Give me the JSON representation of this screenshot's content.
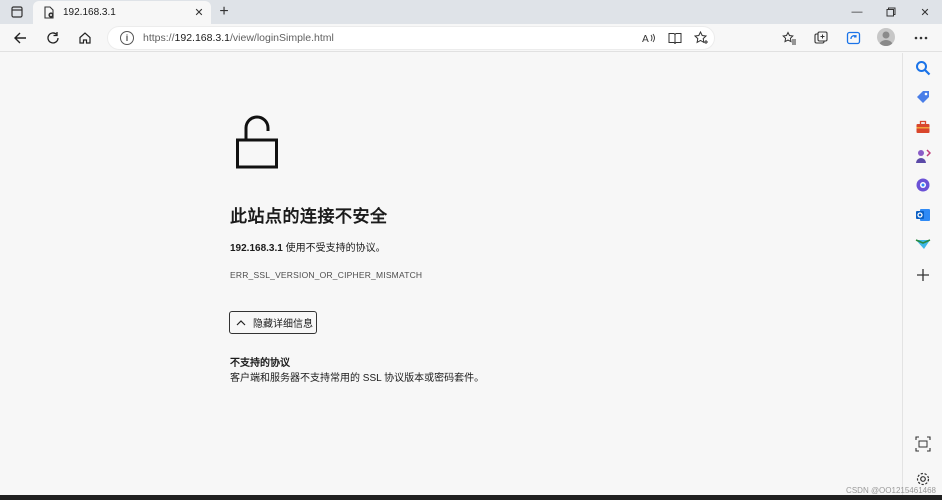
{
  "tab": {
    "title": "192.168.3.1"
  },
  "addressbar": {
    "url_prefix": "https://",
    "url_host": "192.168.3.1",
    "url_path": "/view/loginSimple.html"
  },
  "content": {
    "heading": "此站点的连接不安全",
    "desc_host": "192.168.3.1",
    "desc_text": " 使用不受支持的协议。",
    "error_code": "ERR_SSL_VERSION_OR_CIPHER_MISMATCH",
    "details_button": "隐藏详细信息",
    "detail_title": "不支持的协议",
    "detail_text": "客户端和服务器不支持常用的 SSL 协议版本或密码套件。"
  },
  "watermark": "CSDN @OO1215461468",
  "icons": {
    "tab_actions": "tab-actions-icon",
    "favicon": "page-icon",
    "back": "back-arrow-icon",
    "refresh": "refresh-icon",
    "home": "home-icon",
    "info": "info-icon",
    "read_aloud": "read-aloud-icon",
    "immersive_reader": "reader-icon",
    "favorite": "star-add-icon",
    "favorites": "favorites-icon",
    "collections": "collections-icon",
    "browser_essentials": "shield-icon",
    "menu": "more-icon",
    "lock": "unlocked-padlock-icon"
  }
}
